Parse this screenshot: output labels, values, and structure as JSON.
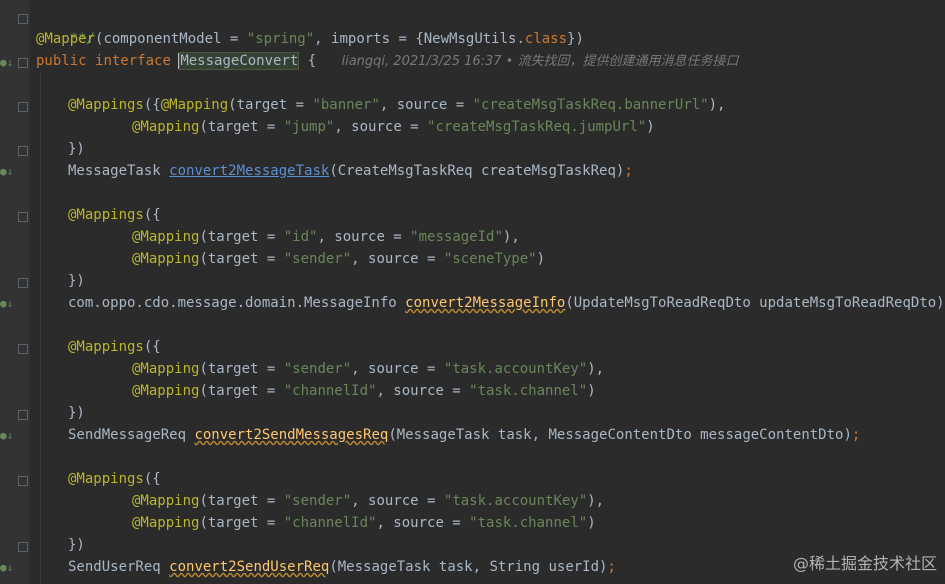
{
  "code": {
    "top_comment": "**/",
    "mapper_annotation": "@Mapper",
    "mapper_args_open": "(componentModel = ",
    "mapper_component_model": "\"spring\"",
    "mapper_imports": ", imports = {NewMsgUtils.",
    "mapper_class_kw": "class",
    "mapper_close": "})",
    "public_kw": "public",
    "interface_kw": "interface",
    "interface_name": "MessageConvert",
    "brace_open": " {",
    "blame_text": "liangqi, 2021/3/25 16:37 • 流失找回，提供创建通用消息任务接口",
    "m1": {
      "mappings": "@Mappings",
      "open": "({",
      "mapping": "@Mapping",
      "t_arg": "(target = ",
      "t1": "\"banner\"",
      "s_arg": ", source = ",
      "s1": "\"createMsgTaskReq.bannerUrl\"",
      "end1": "),",
      "t2": "\"jump\"",
      "s2": "\"createMsgTaskReq.jumpUrl\"",
      "end2": ")",
      "close": "})",
      "ret": "MessageTask ",
      "method": "convert2MessageTask",
      "params": "(CreateMsgTaskReq createMsgTaskReq)",
      "semi": ";"
    },
    "m2": {
      "mappings": "@Mappings",
      "open": "({",
      "mapping": "@Mapping",
      "t_arg": "(target = ",
      "t1": "\"id\"",
      "s_arg": ", source = ",
      "s1": "\"messageId\"",
      "end1": "),",
      "t2": "\"sender\"",
      "s2": "\"sceneType\"",
      "end2": ")",
      "close": "})",
      "ret": "com.oppo.cdo.message.domain.MessageInfo ",
      "method": "convert2MessageInfo",
      "params": "(UpdateMsgToReadReqDto updateMsgToReadReqDto)",
      "semi": ";"
    },
    "m3": {
      "mappings": "@Mappings",
      "open": "({",
      "mapping": "@Mapping",
      "t_arg": "(target = ",
      "t1": "\"sender\"",
      "s_arg": ", source = ",
      "s1": "\"task.accountKey\"",
      "end1": "),",
      "t2": "\"channelId\"",
      "s2": "\"task.channel\"",
      "end2": ")",
      "close": "})",
      "ret": "SendMessageReq ",
      "method": "convert2SendMessagesReq",
      "params": "(MessageTask task, MessageContentDto messageContentDto)",
      "semi": ";"
    },
    "m4": {
      "mappings": "@Mappings",
      "open": "({",
      "mapping": "@Mapping",
      "t_arg": "(target = ",
      "t1": "\"sender\"",
      "s_arg": ", source = ",
      "s1": "\"task.accountKey\"",
      "end1": "),",
      "t2": "\"channelId\"",
      "s2": "\"task.channel\"",
      "end2": ")",
      "close": "})",
      "ret": "SendUserReq ",
      "method": "convert2SendUserReq",
      "params": "(MessageTask task, String userId)",
      "semi": ";"
    }
  },
  "watermark": "@稀土掘金技术社区",
  "colors": {
    "background": "#2b2b2b",
    "keyword": "#cc7832",
    "string": "#6a8759",
    "annotation": "#bbb529",
    "method": "#ffc66d"
  }
}
